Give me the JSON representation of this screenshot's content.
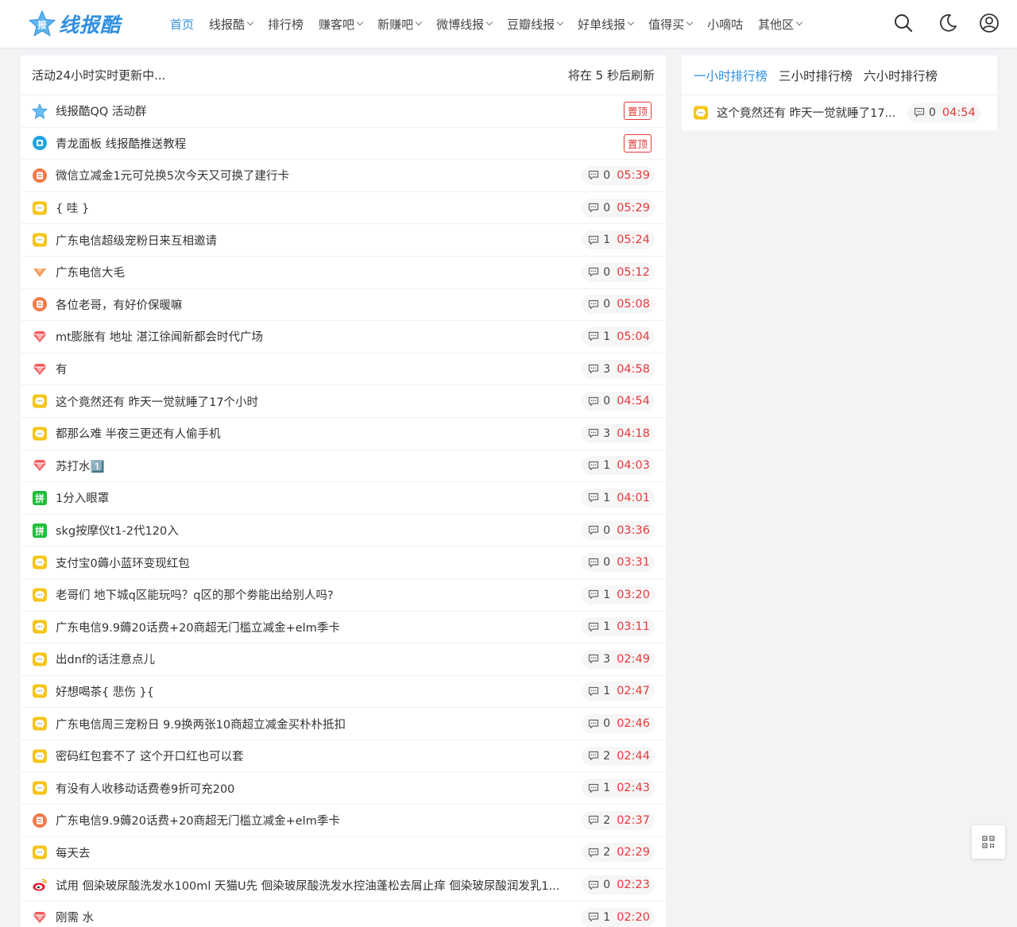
{
  "brand": {
    "name": "线报酷",
    "badge": "报"
  },
  "nav": [
    {
      "label": "首页",
      "dropdown": false,
      "active": true
    },
    {
      "label": "线报酷",
      "dropdown": true
    },
    {
      "label": "排行榜",
      "dropdown": false
    },
    {
      "label": "赚客吧",
      "dropdown": true
    },
    {
      "label": "新赚吧",
      "dropdown": true
    },
    {
      "label": "微博线报",
      "dropdown": true
    },
    {
      "label": "豆瓣线报",
      "dropdown": true
    },
    {
      "label": "好单线报",
      "dropdown": true
    },
    {
      "label": "值得买",
      "dropdown": true
    },
    {
      "label": "小嘀咕",
      "dropdown": false
    },
    {
      "label": "其他区",
      "dropdown": true
    }
  ],
  "header_icons": [
    "search-icon",
    "moon-icon",
    "user-icon"
  ],
  "feed": {
    "heading": "活动24小时实时更新中...",
    "refresh_text": "将在 5 秒后刷新",
    "pinned_label": "置顶",
    "items": [
      {
        "title": "线报酷QQ 活动群",
        "icon": "star",
        "pinned": true
      },
      {
        "title": "青龙面板 线报酷推送教程",
        "icon": "qinglong",
        "pinned": true
      },
      {
        "title": "微信立减金1元可兑换5次今天又可换了建行卡",
        "icon": "zhuan",
        "comments": "0",
        "time": "05:39"
      },
      {
        "title": "{ 哇 }",
        "icon": "chat",
        "comments": "0",
        "time": "05:29"
      },
      {
        "title": "广东电信超级宠粉日来互相邀请",
        "icon": "chat",
        "comments": "1",
        "time": "05:24"
      },
      {
        "title": "广东电信大毛",
        "icon": "douban",
        "comments": "0",
        "time": "05:12"
      },
      {
        "title": "各位老哥，有好价保暖嘛",
        "icon": "zhuan",
        "comments": "0",
        "time": "05:08"
      },
      {
        "title": "mt膨胀有 地址 湛江徐闻新都会时代广场",
        "icon": "diamond",
        "comments": "1",
        "time": "05:04"
      },
      {
        "title": "有",
        "icon": "diamond",
        "comments": "3",
        "time": "04:58"
      },
      {
        "title": "这个竟然还有 昨天一觉就睡了17个小时",
        "icon": "chat",
        "comments": "0",
        "time": "04:54"
      },
      {
        "title": "都那么难 半夜三更还有人偷手机",
        "icon": "chat",
        "comments": "3",
        "time": "04:18"
      },
      {
        "title": "苏打水1️⃣",
        "icon": "diamond",
        "comments": "1",
        "time": "04:03"
      },
      {
        "title": "1分入眼罩",
        "icon": "pin",
        "comments": "1",
        "time": "04:01"
      },
      {
        "title": "skg按摩仪t1-2代120入",
        "icon": "pin",
        "comments": "0",
        "time": "03:36"
      },
      {
        "title": "支付宝0薅小蓝环变现红包",
        "icon": "chat",
        "comments": "0",
        "time": "03:31"
      },
      {
        "title": "老哥们 地下城q区能玩吗？q区的那个劵能出给别人吗?",
        "icon": "chat",
        "comments": "1",
        "time": "03:20"
      },
      {
        "title": "广东电信9.9薅20话费+20商超无门槛立减金+elm季卡",
        "icon": "chat",
        "comments": "1",
        "time": "03:11"
      },
      {
        "title": "出dnf的话注意点儿",
        "icon": "chat",
        "comments": "3",
        "time": "02:49"
      },
      {
        "title": "好想喝茶{ 悲伤 }{",
        "icon": "chat",
        "comments": "1",
        "time": "02:47"
      },
      {
        "title": "广东电信周三宠粉日 9.9换两张10商超立减金买朴朴抵扣",
        "icon": "chat",
        "comments": "0",
        "time": "02:46"
      },
      {
        "title": "密码红包套不了 这个开口红也可以套",
        "icon": "chat",
        "comments": "2",
        "time": "02:44"
      },
      {
        "title": "有没有人收移动话费卷9折可充200",
        "icon": "chat",
        "comments": "1",
        "time": "02:43"
      },
      {
        "title": "广东电信9.9薅20话费+20商超无门槛立减金+elm季卡",
        "icon": "zhuan",
        "comments": "2",
        "time": "02:37"
      },
      {
        "title": "每天去",
        "icon": "chat",
        "comments": "2",
        "time": "02:29"
      },
      {
        "title": "试用 佪染玻尿酸洗发水100ml 天猫U先 佪染玻尿酸洗发水控油蓬松去屑止痒 佪染玻尿酸润发乳1...",
        "icon": "weibo",
        "comments": "0",
        "time": "02:23"
      },
      {
        "title": "刚需 水",
        "icon": "diamond",
        "comments": "1",
        "time": "02:20"
      }
    ]
  },
  "ranking": {
    "tabs": [
      {
        "label": "一小时排行榜",
        "active": true
      },
      {
        "label": "三小时排行榜"
      },
      {
        "label": "六小时排行榜"
      }
    ],
    "items": [
      {
        "title": "这个竟然还有 昨天一觉就睡了17...",
        "icon": "chat",
        "comments": "0",
        "time": "04:54"
      }
    ]
  },
  "float_button": "qrcode-icon",
  "colors": {
    "accent": "#2f8fe0",
    "time": "#e5393a",
    "pin_border": "#e5393a"
  }
}
